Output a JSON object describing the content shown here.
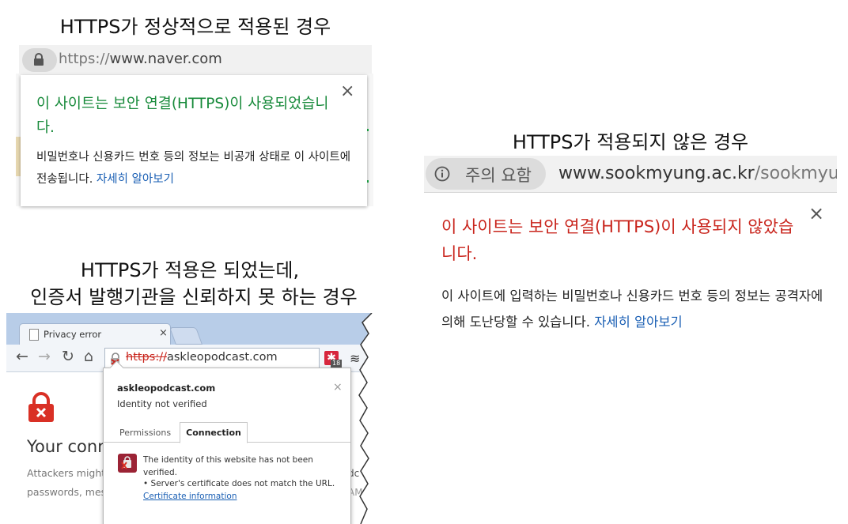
{
  "panel_secure": {
    "heading": "HTTPS가 정상적으로 적용된 경우",
    "address_bar": {
      "scheme": "https://",
      "host": "www.naver.com",
      "icon": "lock-icon"
    },
    "popup": {
      "title": "이 사이트는 보안 연결(HTTPS)이 사용되었습니다.",
      "description": "비밀번호나 신용카드 번호 등의 정보는 비공개 상태로 이 사이트에 전송됩니다.",
      "link": "자세히 알아보기",
      "close_symbol": "×"
    },
    "colors": {
      "title": "#178a3a",
      "link": "#1a5fb4"
    }
  },
  "panel_insecure": {
    "heading": "HTTPS가 적용되지 않은 경우",
    "address_bar": {
      "badge_label": "주의 요함",
      "host": "www.sookmyung.ac.kr",
      "path": "/sookmyung",
      "icon": "info-icon"
    },
    "popup": {
      "title": "이 사이트는 보안 연결(HTTPS)이 사용되지 않았습니다.",
      "description": "이 사이트에 입력하는 비밀번호나 신용카드 번호 등의 정보는 공격자에 의해 도난당할 수 있습니다.",
      "link": "자세히 알아보기",
      "close_symbol": "×"
    },
    "colors": {
      "title": "#c9251d",
      "link": "#1a5fb4"
    }
  },
  "panel_untrusted": {
    "heading_line1": "HTTPS가 적용은 되었는데,",
    "heading_line2": "인증서 발행기관을 신뢰하지 못 하는 경우",
    "browser": {
      "tab_title": "Privacy error",
      "tab_close": "×",
      "url_scheme": "https://",
      "url_host": "askleopodcast.com",
      "extension_badge": "18",
      "error_title": "Your conn",
      "error_text_1": "Attackers might",
      "error_text_2": "passwords, mes",
      "right_fragment_1": "dc",
      "right_fragment_2": "AM"
    },
    "popup": {
      "site": "askleopodcast.com",
      "identity": "Identity not verified",
      "tab_permissions": "Permissions",
      "tab_connection": "Connection",
      "warning": "The identity of this website has not been verified.",
      "bullet": "• Server's certificate does not match the URL.",
      "link": "Certificate information",
      "close_symbol": "×"
    }
  }
}
